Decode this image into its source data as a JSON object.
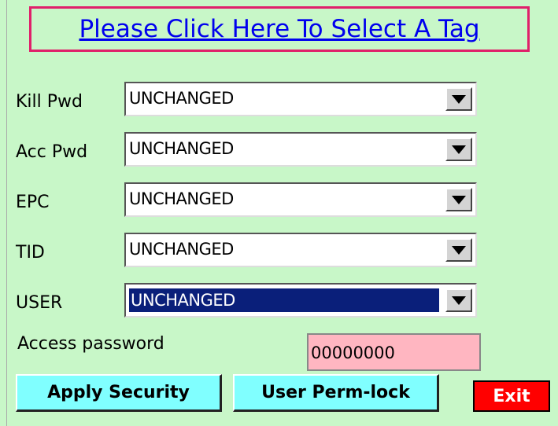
{
  "header": {
    "select_tag_link": "Please Click Here To Select A Tag"
  },
  "fields": [
    {
      "label": "Kill Pwd",
      "value": "UNCHANGED"
    },
    {
      "label": "Acc Pwd",
      "value": "UNCHANGED"
    },
    {
      "label": "EPC",
      "value": "UNCHANGED"
    },
    {
      "label": "TID",
      "value": "UNCHANGED"
    },
    {
      "label": "USER",
      "value": "UNCHANGED",
      "selected": true
    }
  ],
  "access_password": {
    "label": "Access password",
    "value": "00000000"
  },
  "buttons": {
    "apply": "Apply Security",
    "perm_lock": "User Perm-lock",
    "exit": "Exit"
  },
  "colors": {
    "background": "#c8f7c8",
    "link": "#0000ee",
    "link_border": "#e0206a",
    "button": "#80ffff",
    "exit": "#ff0000",
    "password_field": "#ffb6c1",
    "selection": "#0a1f7a"
  }
}
